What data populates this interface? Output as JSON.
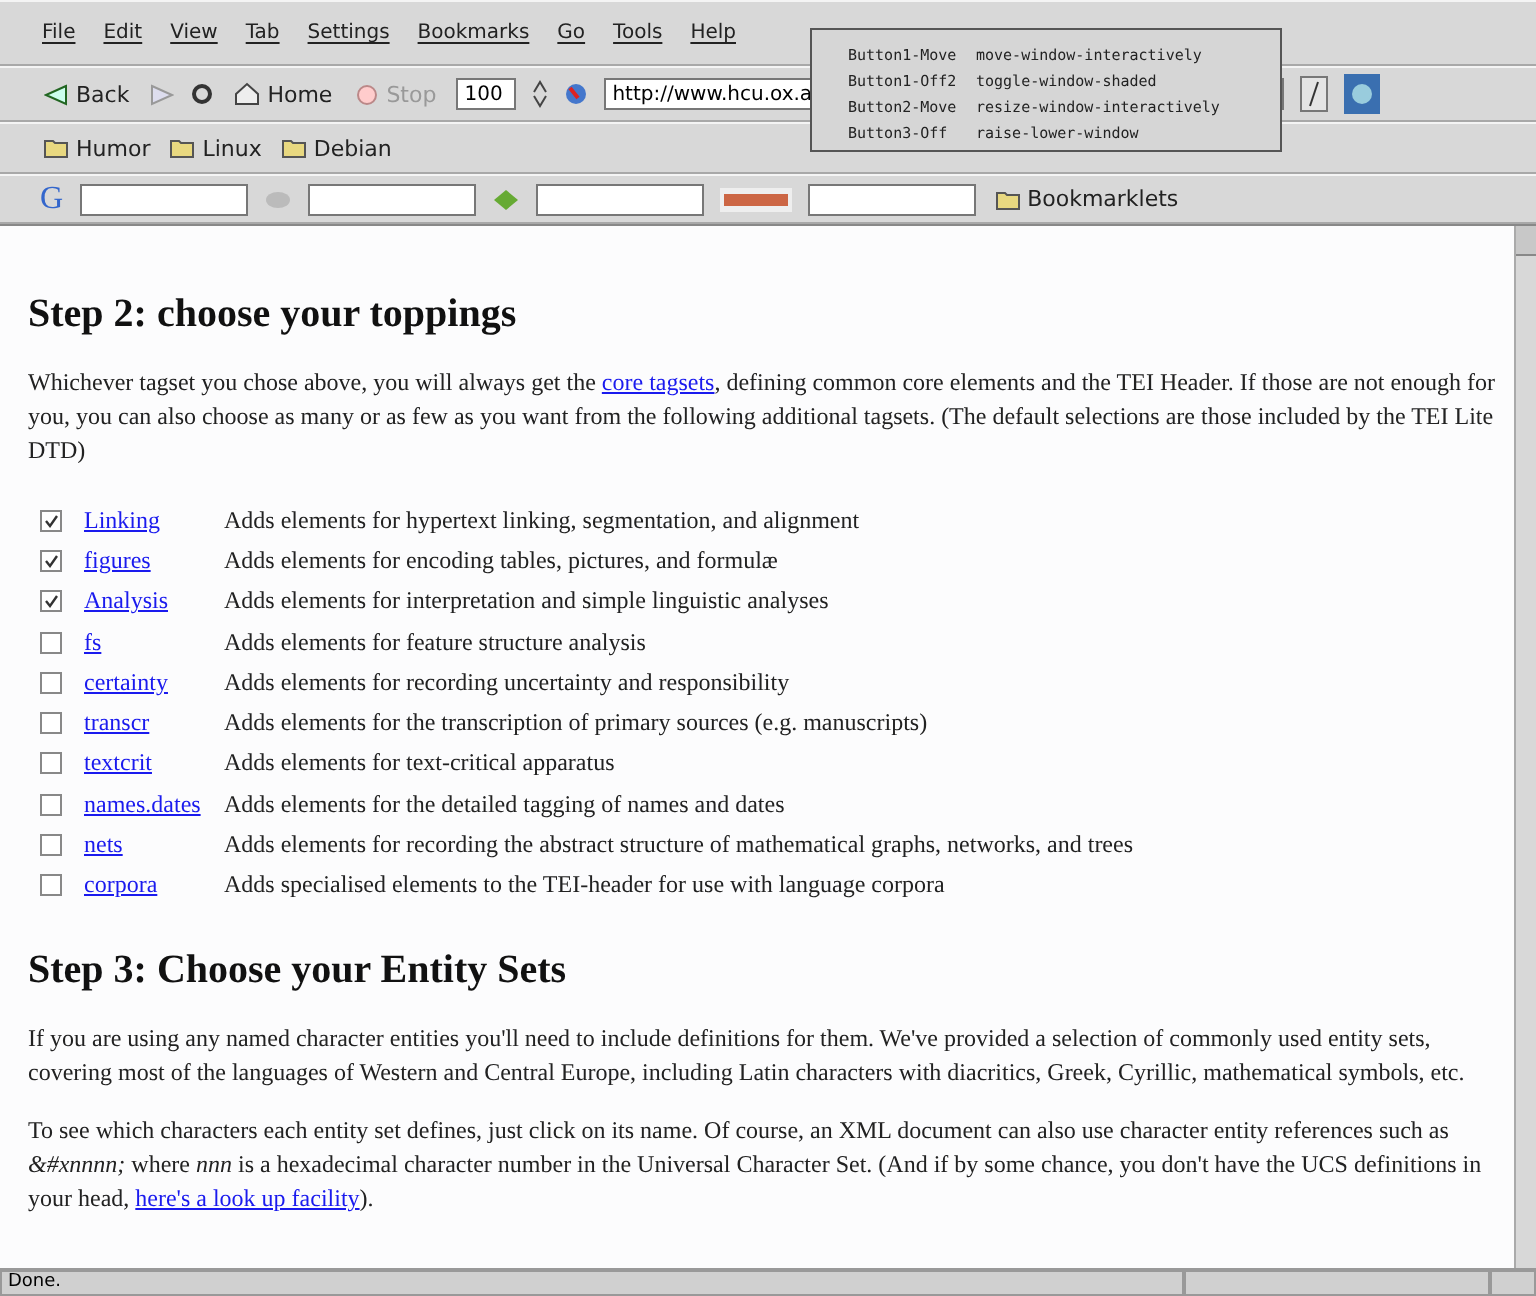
{
  "menu": [
    "File",
    "Edit",
    "View",
    "Tab",
    "Settings",
    "Bookmarks",
    "Go",
    "Tools",
    "Help"
  ],
  "navigation": {
    "back": "Back",
    "home": "Home",
    "stop": "Stop",
    "zoom": "100",
    "url": "http://www.hcu.ox.a"
  },
  "bookmarks": [
    "Humor",
    "Linux",
    "Debian"
  ],
  "search_bar": {
    "logo": "G",
    "bookmarklets": "Bookmarklets"
  },
  "tooltip": [
    {
      "binding": "Button1-Move",
      "action": "move-window-interactively"
    },
    {
      "binding": "Button1-Off2",
      "action": "toggle-window-shaded"
    },
    {
      "binding": "Button2-Move",
      "action": "resize-window-interactively"
    },
    {
      "binding": "Button3-Off",
      "action": "raise-lower-window"
    }
  ],
  "step2": {
    "heading": "Step 2: choose your toppings",
    "intro": {
      "before": "Whichever tagset you chose above, you will always get the ",
      "link": "core tagsets",
      "after": ", defining common core elements and the TEI Header. If those are not enough for you, you can also choose as many or as few as you want from the following additional tagsets. (The default selections are those included by the TEI Lite DTD)"
    },
    "tagsets": [
      {
        "name": "Linking",
        "checked": true,
        "description": "Adds elements for hypertext linking, segmentation, and alignment"
      },
      {
        "name": "figures",
        "checked": true,
        "description": "Adds elements for encoding tables, pictures, and formulæ"
      },
      {
        "name": "Analysis",
        "checked": true,
        "description": "Adds elements for interpretation and simple linguistic analyses"
      },
      {
        "name": "fs",
        "checked": false,
        "description": "Adds elements for feature structure analysis"
      },
      {
        "name": "certainty",
        "checked": false,
        "description": "Adds elements for recording uncertainty and responsibility"
      },
      {
        "name": "transcr",
        "checked": false,
        "description": "Adds elements for the transcription of primary sources (e.g. manuscripts)"
      },
      {
        "name": "textcrit",
        "checked": false,
        "description": "Adds elements for text-critical apparatus"
      },
      {
        "name": "names.dates",
        "checked": false,
        "description": "Adds elements for the detailed tagging of names and dates"
      },
      {
        "name": "nets",
        "checked": false,
        "description": "Adds elements for recording the abstract structure of mathematical graphs, networks, and trees"
      },
      {
        "name": "corpora",
        "checked": false,
        "description": "Adds specialised elements to the TEI-header for use with language corpora"
      }
    ]
  },
  "step3": {
    "heading": "Step 3: Choose your Entity Sets",
    "paragraph": "If you are using any named character entities you'll need to include definitions for them. We've provided a selection of commonly used entity sets, covering most of the languages of Western and Central Europe, including Latin characters with diacritics, Greek, Cyrillic, mathematical symbols, etc.",
    "lookup": {
      "before": "To see which characters each entity set defines, just click on its name. Of course, an XML document can also use character entity references such as *&#xnnnn;* where *nnn* is a hexadecimal character number in the Universal Character Set. (And if by some chance, you don't have the UCS definitions in your head, ",
      "link": "here's a look up facility",
      "after": ")."
    }
  },
  "status_bar": "Done."
}
